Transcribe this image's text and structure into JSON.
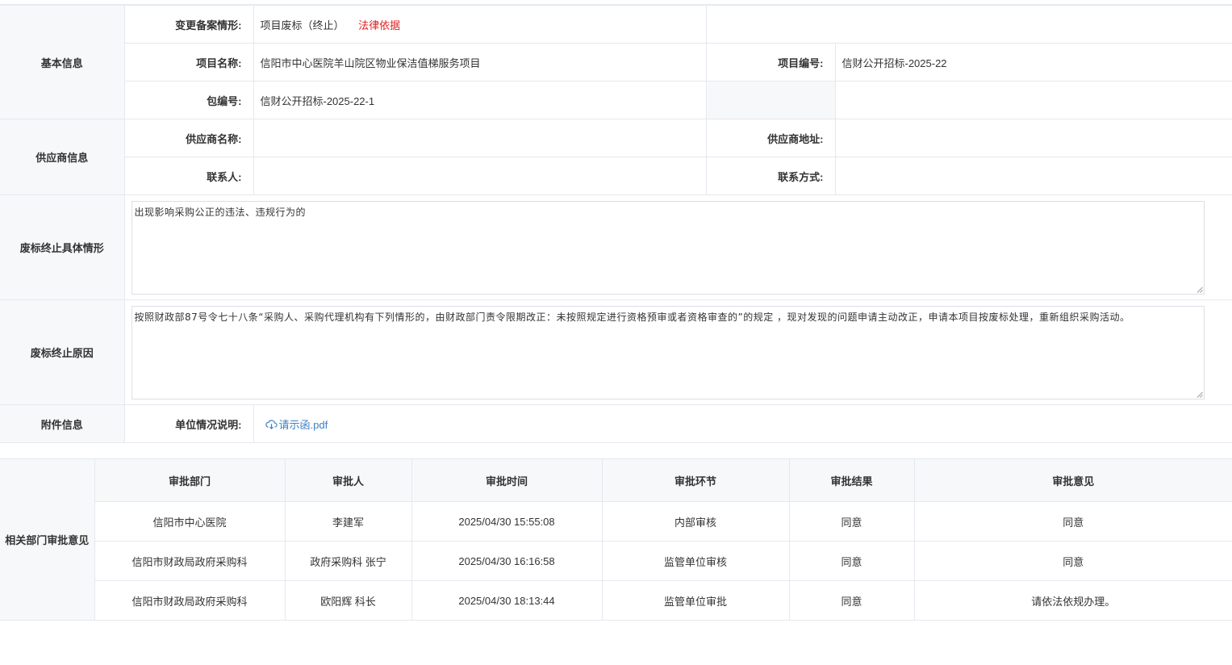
{
  "basic": {
    "section_label": "基本信息",
    "change_label": "变更备案情形:",
    "change_value": "项目废标（终止）",
    "legal_link": "法律依据",
    "name_label": "项目名称:",
    "name_value": "信阳市中心医院羊山院区物业保洁值梯服务项目",
    "number_label": "项目编号:",
    "number_value": "信财公开招标-2025-22",
    "package_label": "包编号:",
    "package_value": "信财公开招标-2025-22-1"
  },
  "supplier": {
    "section_label": "供应商信息",
    "name_label": "供应商名称:",
    "name_value": "",
    "address_label": "供应商地址:",
    "address_value": "",
    "contact_label": "联系人:",
    "contact_value": "",
    "phone_label": "联系方式:",
    "phone_value": ""
  },
  "situation": {
    "section_label": "废标终止具体情形",
    "text": "出现影响采购公正的违法、违规行为的"
  },
  "reason": {
    "section_label": "废标终止原因",
    "text": "按照财政部87号令七十八条“采购人、采购代理机构有下列情形的，由财政部门责令限期改正：未按照规定进行资格预审或者资格审查的”的规定 ，现对发现的问题申请主动改正，申请本项目按废标处理，重新组织采购活动。"
  },
  "attachment": {
    "section_label": "附件信息",
    "label": "单位情况说明:",
    "file_name": "请示函.pdf",
    "file_icon": "cloud-download-icon"
  },
  "approval": {
    "section_label": "相关部门审批意见",
    "headers": [
      "审批部门",
      "审批人",
      "审批时间",
      "审批环节",
      "审批结果",
      "审批意见"
    ],
    "rows": [
      [
        "信阳市中心医院",
        "李建军",
        "2025/04/30 15:55:08",
        "内部审核",
        "同意",
        "同意"
      ],
      [
        "信阳市财政局政府采购科",
        "政府采购科 张宁",
        "2025/04/30 16:16:58",
        "监管单位审核",
        "同意",
        "同意"
      ],
      [
        "信阳市财政局政府采购科",
        "欧阳辉 科长",
        "2025/04/30 18:13:44",
        "监管单位审批",
        "同意",
        "请依法依规办理。"
      ]
    ]
  },
  "colors": {
    "legal_link": "#e02020",
    "file_link": "#3b7fc4",
    "label_bg": "#f7f8fa",
    "border": "#e5e8ee"
  }
}
